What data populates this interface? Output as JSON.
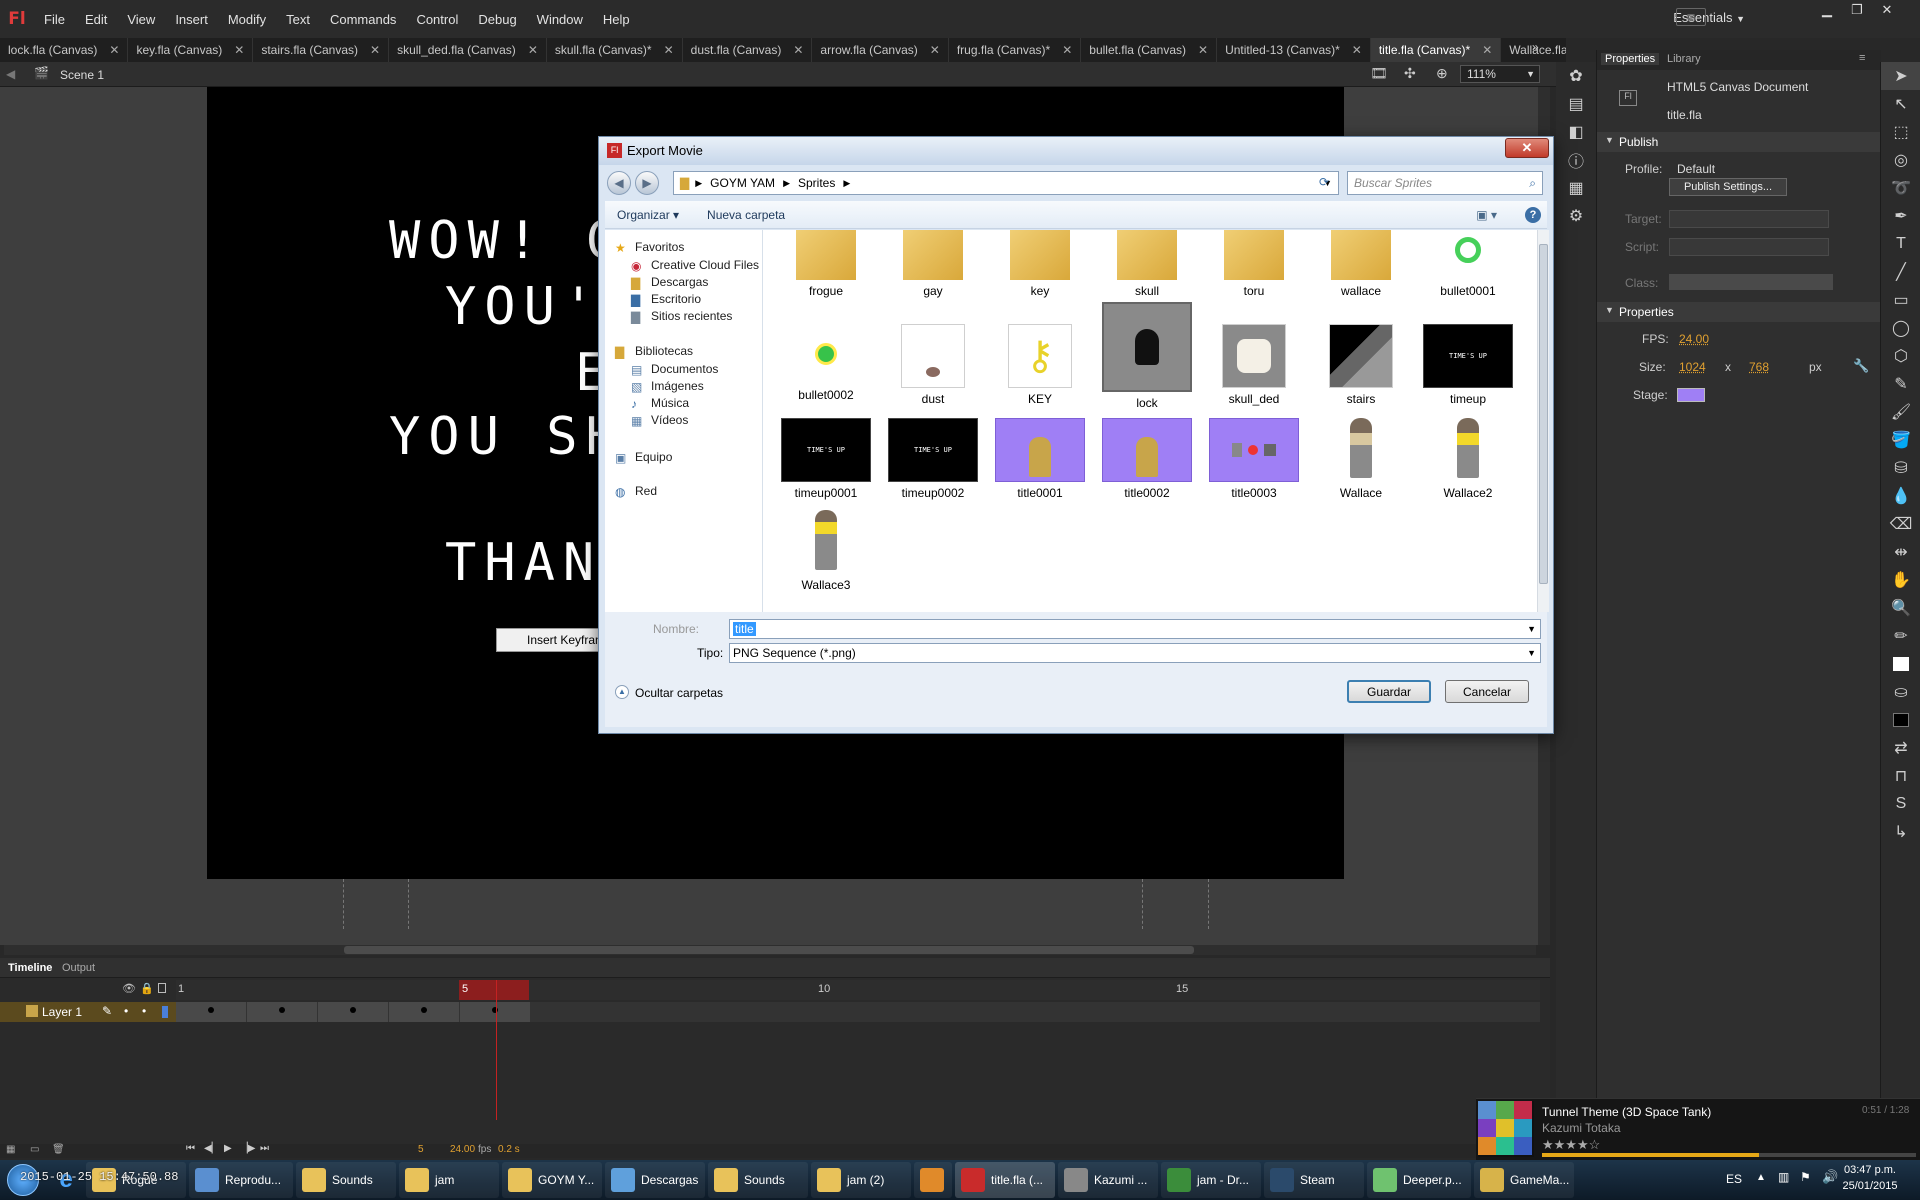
{
  "menubar": {
    "logo": "Fl",
    "items": [
      "File",
      "Edit",
      "View",
      "Insert",
      "Modify",
      "Text",
      "Commands",
      "Control",
      "Debug",
      "Window",
      "Help"
    ],
    "workspace": "Essentials"
  },
  "tabs": [
    {
      "label": "lock.fla (Canvas)",
      "active": false
    },
    {
      "label": "key.fla (Canvas)",
      "active": false
    },
    {
      "label": "stairs.fla (Canvas)",
      "active": false
    },
    {
      "label": "skull_ded.fla (Canvas)",
      "active": false
    },
    {
      "label": "skull.fla (Canvas)*",
      "active": false
    },
    {
      "label": "dust.fla (Canvas)",
      "active": false
    },
    {
      "label": "arrow.fla (Canvas)",
      "active": false
    },
    {
      "label": "frug.fla (Canvas)*",
      "active": false
    },
    {
      "label": "bullet.fla (Canvas)",
      "active": false
    },
    {
      "label": "Untitled-13 (Canvas)*",
      "active": false
    },
    {
      "label": "title.fla (Canvas)*",
      "active": true
    },
    {
      "label": "Wallace.fla (Ca",
      "active": false
    }
  ],
  "editbar": {
    "scene": "Scene 1",
    "zoom": "111%"
  },
  "stage": {
    "lines": [
      "WOW! C",
      "YOU'",
      "E",
      "YOU SH",
      "THAN"
    ]
  },
  "dialog": {
    "title": "Export Movie",
    "title_icon": "Fl",
    "breadcrumb": [
      "GOYM YAM",
      "Sprites"
    ],
    "search_placeholder": "Buscar Sprites",
    "organize": "Organizar",
    "new_folder": "Nueva carpeta",
    "nav": {
      "favorites": "Favoritos",
      "fav_items": [
        "Creative Cloud Files",
        "Descargas",
        "Escritorio",
        "Sitios recientes"
      ],
      "libraries": "Bibliotecas",
      "lib_items": [
        "Documentos",
        "Imágenes",
        "Música",
        "Vídeos"
      ],
      "computer": "Equipo",
      "network": "Red"
    },
    "files": [
      {
        "name": "frogue",
        "kind": "folder"
      },
      {
        "name": "gay",
        "kind": "folder"
      },
      {
        "name": "key",
        "kind": "folder"
      },
      {
        "name": "skull",
        "kind": "folder"
      },
      {
        "name": "toru",
        "kind": "folder"
      },
      {
        "name": "wallace",
        "kind": "folder"
      },
      {
        "name": "bullet0001",
        "kind": "ring"
      },
      {
        "name": "bullet0002",
        "kind": "dot"
      },
      {
        "name": "dust",
        "kind": "dust"
      },
      {
        "name": "KEY",
        "kind": "key"
      },
      {
        "name": "lock",
        "kind": "lock"
      },
      {
        "name": "skull_ded",
        "kind": "skull"
      },
      {
        "name": "stairs",
        "kind": "stairs"
      },
      {
        "name": "timeup",
        "kind": "timeup"
      },
      {
        "name": "timeup0001",
        "kind": "timeup"
      },
      {
        "name": "timeup0002",
        "kind": "timeup"
      },
      {
        "name": "title0001",
        "kind": "title"
      },
      {
        "name": "title0002",
        "kind": "title"
      },
      {
        "name": "title0003",
        "kind": "title3"
      },
      {
        "name": "Wallace",
        "kind": "wallace"
      },
      {
        "name": "Wallace2",
        "kind": "wallace2"
      },
      {
        "name": "Wallace3",
        "kind": "wallace3"
      }
    ],
    "timeup_text": "TIME'S UP",
    "name_label": "Nombre:",
    "name_value": "title",
    "type_label": "Tipo:",
    "type_value": "PNG Sequence (*.png)",
    "hide_folders": "Ocultar carpetas",
    "save": "Guardar",
    "cancel": "Cancelar"
  },
  "context_menu": {
    "item": "Insert Keyframe"
  },
  "right_panel": {
    "tabs": [
      "Properties",
      "Library"
    ],
    "doc_type": "HTML5 Canvas Document",
    "doc_name": "title.fla",
    "publish_header": "Publish",
    "profile_label": "Profile:",
    "profile_value": "Default",
    "publish_settings": "Publish Settings...",
    "target_label": "Target:",
    "script_label": "Script:",
    "class_label": "Class:",
    "properties_header": "Properties",
    "fps_label": "FPS:",
    "fps_value": "24.00",
    "size_label": "Size:",
    "width": "1024",
    "x": "x",
    "height": "768",
    "unit": "px",
    "stage_label": "Stage:",
    "stage_color": "#9f7ff5"
  },
  "timeline": {
    "tabs": [
      "Timeline",
      "Output"
    ],
    "layer": "Layer 1",
    "frame_numbers": [
      "1",
      "5",
      "10",
      "15"
    ],
    "current_frame": "5",
    "fps": "24.00",
    "fps_unit": "fps",
    "elapsed": "0.2 s"
  },
  "music": {
    "title": "Tunnel Theme (3D Space Tank)",
    "artist": "Kazumi Totaka",
    "time": "0:51 / 1:28",
    "rating_stars": 4,
    "progress": 0.58
  },
  "taskbar": {
    "overlay_text": "2015-01-25 15:47:50.88",
    "items": [
      {
        "label": "Rogue",
        "color": "#e8c25a"
      },
      {
        "label": "Reprodu...",
        "color": "#5a8fd0"
      },
      {
        "label": "Sounds",
        "color": "#e8c25a"
      },
      {
        "label": "jam",
        "color": "#e8c25a"
      },
      {
        "label": "GOYM Y...",
        "color": "#e8c25a"
      },
      {
        "label": "Descargas",
        "color": "#5fa0dc"
      },
      {
        "label": "Sounds",
        "color": "#e8c25a"
      },
      {
        "label": "jam (2)",
        "color": "#e8c25a"
      },
      {
        "label": "",
        "color": "#e08a2a"
      },
      {
        "label": "title.fla (...",
        "color": "#c92b2b"
      },
      {
        "label": "Kazumi ...",
        "color": "#888888"
      },
      {
        "label": "jam - Dr...",
        "color": "#3b8d3b"
      },
      {
        "label": "Steam",
        "color": "#2b4a6b"
      },
      {
        "label": "Deeper.p...",
        "color": "#6fc26f"
      },
      {
        "label": "GameMa...",
        "color": "#d7b34a"
      }
    ],
    "lang": "ES",
    "time": "03:47 p.m.",
    "date": "25/01/2015"
  }
}
